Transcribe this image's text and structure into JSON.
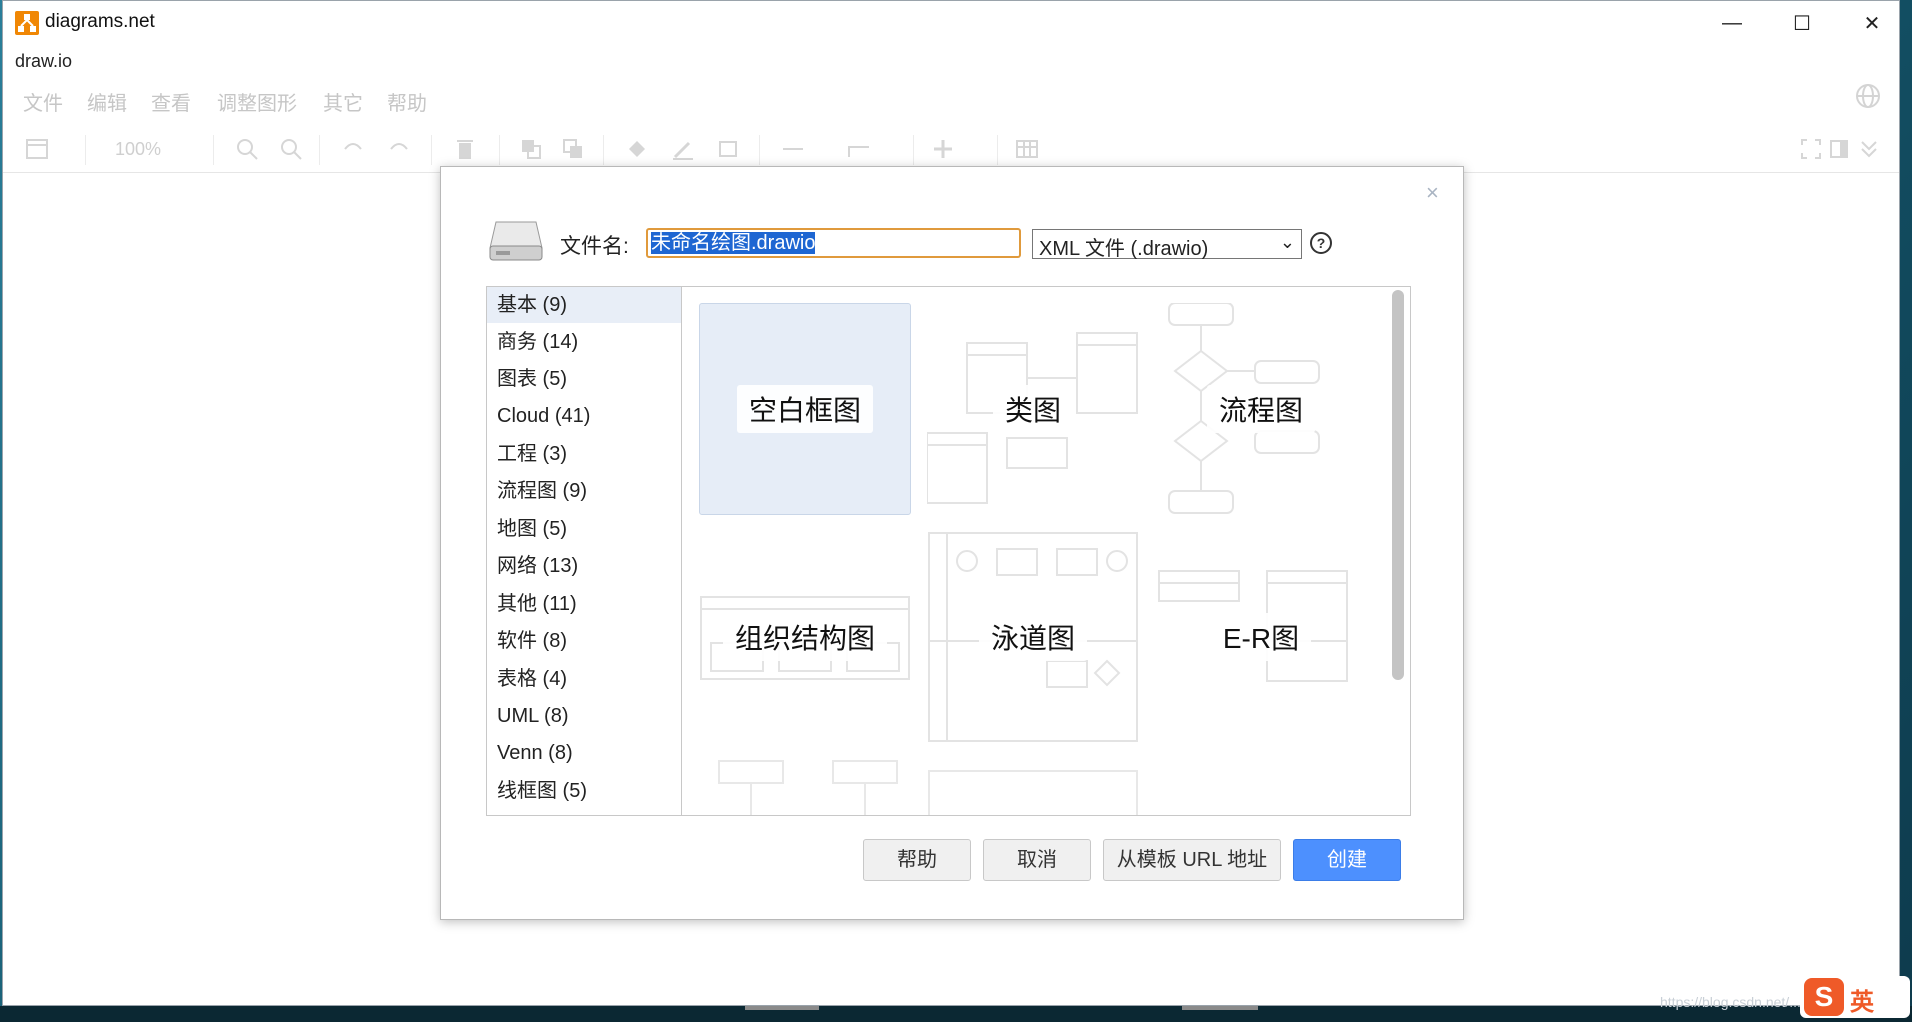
{
  "window": {
    "title": "diagrams.net",
    "subtitle": "draw.io",
    "controls": {
      "minimize": "—",
      "maximize": "☐",
      "close": "✕"
    }
  },
  "menubar": {
    "items": [
      "文件",
      "编辑",
      "查看",
      "调整图形",
      "其它",
      "帮助"
    ]
  },
  "toolbar": {
    "zoom": "100%"
  },
  "dialog": {
    "close": "×",
    "filename_label": "文件名:",
    "filename_value": "未命名绘图.drawio",
    "format_value": "XML 文件 (.drawio)",
    "help_icon": "?",
    "categories": [
      {
        "label": "基本 (9)",
        "selected": true
      },
      {
        "label": "商务 (14)"
      },
      {
        "label": "图表 (5)"
      },
      {
        "label": "Cloud (41)"
      },
      {
        "label": "工程 (3)"
      },
      {
        "label": "流程图 (9)"
      },
      {
        "label": "地图 (5)"
      },
      {
        "label": "网络 (13)"
      },
      {
        "label": "其他 (11)"
      },
      {
        "label": "软件 (8)"
      },
      {
        "label": "表格 (4)"
      },
      {
        "label": "UML (8)"
      },
      {
        "label": "Venn (8)"
      },
      {
        "label": "线框图 (5)"
      }
    ],
    "templates": [
      {
        "label": "空白框图",
        "selected": true
      },
      {
        "label": "类图"
      },
      {
        "label": "流程图"
      },
      {
        "label": "组织结构图"
      },
      {
        "label": "泳道图"
      },
      {
        "label": "E-R图"
      }
    ],
    "buttons": {
      "help": "帮助",
      "cancel": "取消",
      "from_url": "从模板 URL 地址",
      "create": "创建"
    }
  },
  "desktop": {
    "watermark": "https://blog.csdn.net/...",
    "ime_letter": "S",
    "ime_lang": "英"
  },
  "colors": {
    "accent": "#4d90fe",
    "logo": "#f08705",
    "selection": "#e6edf7"
  }
}
